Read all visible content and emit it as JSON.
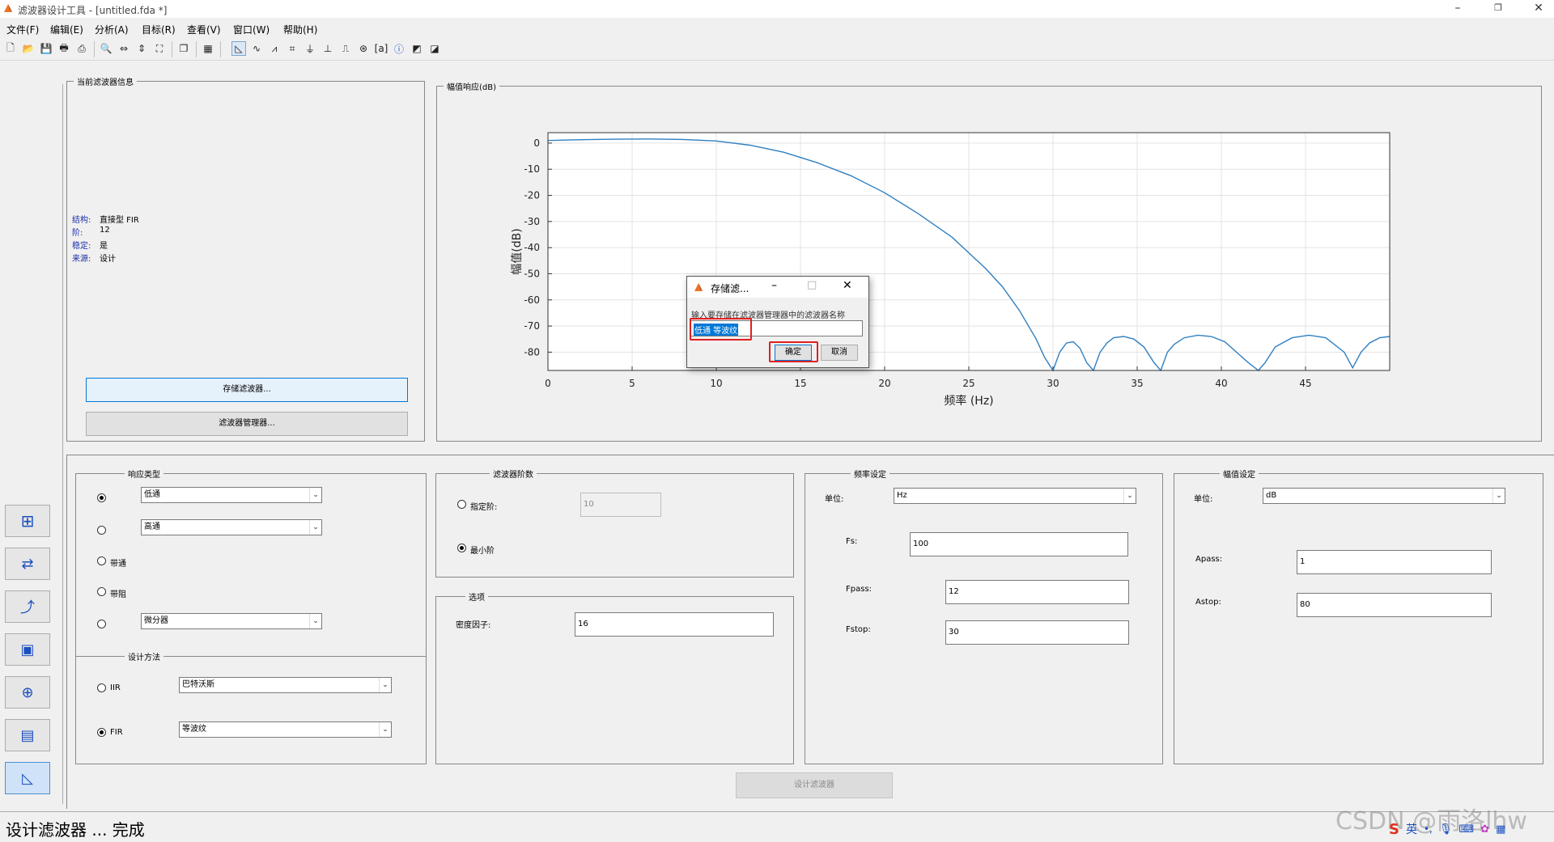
{
  "window": {
    "title": "滤波器设计工具 - [untitled.fda *]"
  },
  "menu": [
    "文件(F)",
    "编辑(E)",
    "分析(A)",
    "目标(R)",
    "查看(V)",
    "窗口(W)",
    "帮助(H)"
  ],
  "info_panel": {
    "title": "当前滤波器信息",
    "rows": [
      {
        "key": "结构:",
        "value": "直接型 FIR"
      },
      {
        "key": "阶:",
        "value": "12"
      },
      {
        "key": "稳定:",
        "value": "是"
      },
      {
        "key": "来源:",
        "value": "设计"
      }
    ],
    "store_button": "存储滤波器...",
    "manager_button": "滤波器管理器..."
  },
  "plot_panel": {
    "title": "幅值响应(dB)"
  },
  "chart_data": {
    "type": "line",
    "xlabel": "频率 (Hz)",
    "ylabel": "幅值(dB)",
    "xlim": [
      0,
      50
    ],
    "ylim": [
      -87,
      4
    ],
    "xticks": [
      0,
      5,
      10,
      15,
      20,
      25,
      30,
      35,
      40,
      45
    ],
    "yticks": [
      0,
      -10,
      -20,
      -30,
      -40,
      -50,
      -60,
      -70,
      -80
    ],
    "grid": true,
    "color": "#2f7fc1",
    "series": [
      {
        "x": [
          0,
          2,
          4,
          6,
          8,
          10,
          12,
          14,
          16,
          18,
          20,
          22,
          24,
          25,
          26,
          27,
          28,
          29,
          29.5,
          30,
          30.4,
          30.8,
          31.2,
          31.6,
          32,
          32.4,
          32.8,
          33.2,
          33.6,
          34.2,
          34.8,
          35.4,
          36,
          36.4,
          36.8,
          37.2,
          37.8,
          38.6,
          39.4,
          40.2,
          40.9,
          41.6,
          42.2,
          42.6,
          43.2,
          44.2,
          45.2,
          46.2,
          47.3,
          47.8,
          48.3,
          48.8,
          49.4,
          50
        ],
        "y": [
          1,
          1.3,
          1.5,
          1.6,
          1.4,
          0.8,
          -0.8,
          -3.5,
          -7.5,
          -12.5,
          -19,
          -27,
          -36,
          -42,
          -48,
          -55,
          -64,
          -75,
          -82,
          -87,
          -80,
          -76.5,
          -76,
          -78.5,
          -84,
          -87,
          -80,
          -76.5,
          -74.5,
          -74,
          -75,
          -78,
          -84,
          -87,
          -80,
          -77,
          -74.5,
          -73.5,
          -74,
          -76,
          -80,
          -84,
          -87,
          -84,
          -78,
          -74.5,
          -73.5,
          -74.5,
          -80,
          -86,
          -80,
          -76.5,
          -74.5,
          -74
        ]
      }
    ]
  },
  "dialog": {
    "title": "存储滤...",
    "prompt": "输入要存储在滤波器管理器中的滤波器名称",
    "input_value": "低通 等波纹",
    "ok": "确定",
    "cancel": "取消"
  },
  "response_type": {
    "title": "响应类型",
    "lowpass_select": "低通",
    "highpass_select": "高通",
    "bandpass": "带通",
    "bandstop": "带阻",
    "differentiator_select": "微分器"
  },
  "design_method": {
    "title": "设计方法",
    "iir": "IIR",
    "iir_select": "巴特沃斯",
    "fir": "FIR",
    "fir_select": "等波纹"
  },
  "filter_order": {
    "title": "滤波器阶数",
    "specify": "指定阶:",
    "specify_value": "10",
    "minimum": "最小阶"
  },
  "options": {
    "title": "选项",
    "density_label": "密度因子:",
    "density_value": "16"
  },
  "freq_spec": {
    "title": "频率设定",
    "units_label": "单位:",
    "units_value": "Hz",
    "fs_label": "Fs:",
    "fs_value": "100",
    "fpass_label": "Fpass:",
    "fpass_value": "12",
    "fstop_label": "Fstop:",
    "fstop_value": "30"
  },
  "mag_spec": {
    "title": "幅值设定",
    "units_label": "单位:",
    "units_value": "dB",
    "apass_label": "Apass:",
    "apass_value": "1",
    "astop_label": "Astop:",
    "astop_value": "80"
  },
  "design_button": "设计滤波器",
  "status": "设计滤波器 ... 完成",
  "watermark": "CSDN @雨洛lhw",
  "tray": {
    "ime": "英"
  }
}
